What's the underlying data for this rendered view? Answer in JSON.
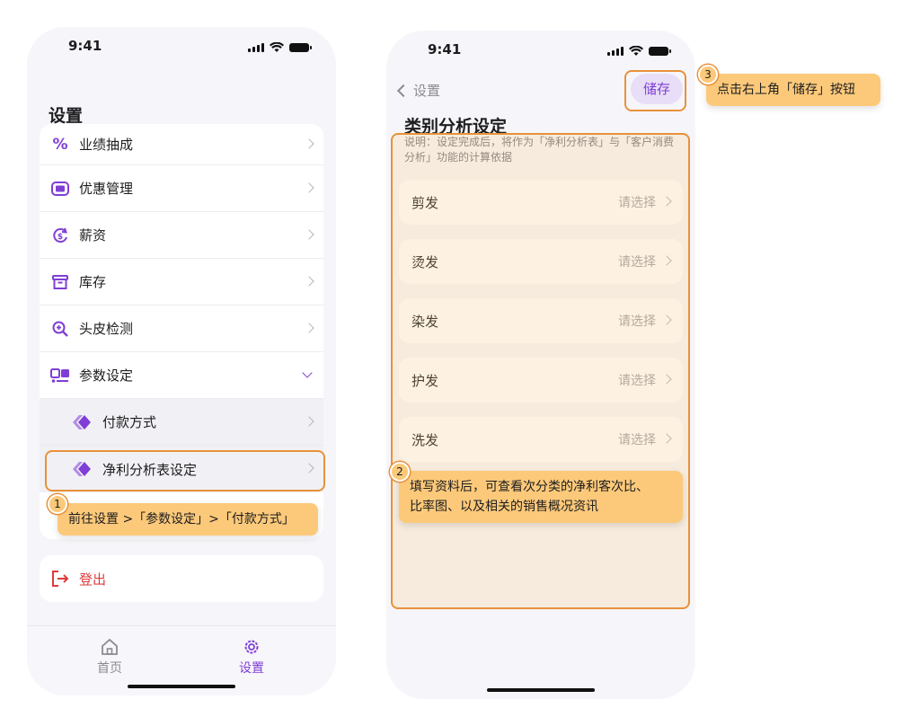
{
  "phone1": {
    "status_time": "9:41",
    "title": "设置",
    "menu": [
      {
        "label": "业绩抽成",
        "icon": "percent-icon"
      },
      {
        "label": "优惠管理",
        "icon": "coupon-icon"
      },
      {
        "label": "薪资",
        "icon": "salary-icon"
      },
      {
        "label": "库存",
        "icon": "inventory-box-icon"
      },
      {
        "label": "头皮检测",
        "icon": "scalp-detection-icon"
      },
      {
        "label": "参数设定",
        "icon": "parameter-settings-icon"
      }
    ],
    "submenu": [
      {
        "label": "付款方式",
        "icon": "diamond-stack-icon"
      },
      {
        "label": "净利分析表设定",
        "icon": "diamond-stack-icon"
      }
    ],
    "logout_label": "登出",
    "tabs": [
      {
        "label": "首页",
        "icon": "home-icon",
        "active": false
      },
      {
        "label": "设置",
        "icon": "gear-icon",
        "active": true
      }
    ]
  },
  "phone2": {
    "status_time": "9:41",
    "back_label": "设置",
    "save_label": "储存",
    "title": "类别分析设定",
    "description": "说明：设定完成后，将作为「净利分析表」与「客户消费分析」功能的计算依据",
    "fields": [
      {
        "label": "剪发",
        "value": "请选择"
      },
      {
        "label": "烫发",
        "value": "请选择"
      },
      {
        "label": "染发",
        "value": "请选择"
      },
      {
        "label": "护发",
        "value": "请选择"
      },
      {
        "label": "洗发",
        "value": "请选择"
      }
    ]
  },
  "annotations": [
    {
      "number": "1",
      "text": "前往设置 >「参数设定」>「付款方式」"
    },
    {
      "number": "2",
      "text_line1": "填写资料后，可查看次分类的净利客次比、",
      "text_line2": "比率图、以及相关的销售概况资讯"
    },
    {
      "number": "3",
      "text": "点击右上角「储存」按钮"
    }
  ],
  "colors": {
    "accent": "#7f3fd6",
    "annotation": "#fcc97a",
    "annotation_border": "#e8913a",
    "logout": "#e03b3b"
  }
}
